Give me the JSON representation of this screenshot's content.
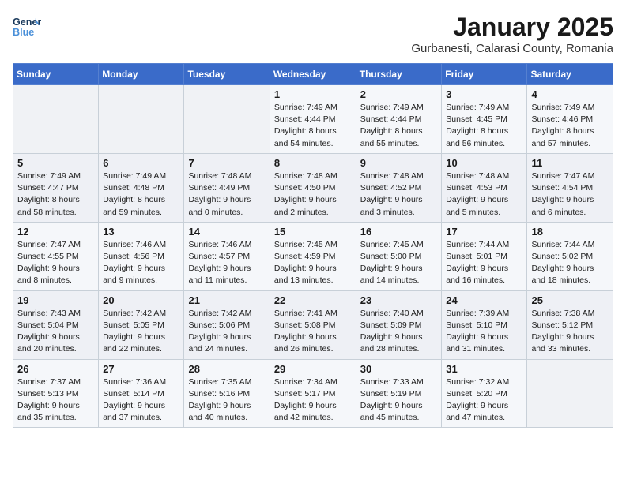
{
  "header": {
    "logo_line1": "General",
    "logo_line2": "Blue",
    "title": "January 2025",
    "subtitle": "Gurbanesti, Calarasi County, Romania"
  },
  "weekdays": [
    "Sunday",
    "Monday",
    "Tuesday",
    "Wednesday",
    "Thursday",
    "Friday",
    "Saturday"
  ],
  "weeks": [
    [
      {
        "day": "",
        "info": ""
      },
      {
        "day": "",
        "info": ""
      },
      {
        "day": "",
        "info": ""
      },
      {
        "day": "1",
        "info": "Sunrise: 7:49 AM\nSunset: 4:44 PM\nDaylight: 8 hours\nand 54 minutes."
      },
      {
        "day": "2",
        "info": "Sunrise: 7:49 AM\nSunset: 4:44 PM\nDaylight: 8 hours\nand 55 minutes."
      },
      {
        "day": "3",
        "info": "Sunrise: 7:49 AM\nSunset: 4:45 PM\nDaylight: 8 hours\nand 56 minutes."
      },
      {
        "day": "4",
        "info": "Sunrise: 7:49 AM\nSunset: 4:46 PM\nDaylight: 8 hours\nand 57 minutes."
      }
    ],
    [
      {
        "day": "5",
        "info": "Sunrise: 7:49 AM\nSunset: 4:47 PM\nDaylight: 8 hours\nand 58 minutes."
      },
      {
        "day": "6",
        "info": "Sunrise: 7:49 AM\nSunset: 4:48 PM\nDaylight: 8 hours\nand 59 minutes."
      },
      {
        "day": "7",
        "info": "Sunrise: 7:48 AM\nSunset: 4:49 PM\nDaylight: 9 hours\nand 0 minutes."
      },
      {
        "day": "8",
        "info": "Sunrise: 7:48 AM\nSunset: 4:50 PM\nDaylight: 9 hours\nand 2 minutes."
      },
      {
        "day": "9",
        "info": "Sunrise: 7:48 AM\nSunset: 4:52 PM\nDaylight: 9 hours\nand 3 minutes."
      },
      {
        "day": "10",
        "info": "Sunrise: 7:48 AM\nSunset: 4:53 PM\nDaylight: 9 hours\nand 5 minutes."
      },
      {
        "day": "11",
        "info": "Sunrise: 7:47 AM\nSunset: 4:54 PM\nDaylight: 9 hours\nand 6 minutes."
      }
    ],
    [
      {
        "day": "12",
        "info": "Sunrise: 7:47 AM\nSunset: 4:55 PM\nDaylight: 9 hours\nand 8 minutes."
      },
      {
        "day": "13",
        "info": "Sunrise: 7:46 AM\nSunset: 4:56 PM\nDaylight: 9 hours\nand 9 minutes."
      },
      {
        "day": "14",
        "info": "Sunrise: 7:46 AM\nSunset: 4:57 PM\nDaylight: 9 hours\nand 11 minutes."
      },
      {
        "day": "15",
        "info": "Sunrise: 7:45 AM\nSunset: 4:59 PM\nDaylight: 9 hours\nand 13 minutes."
      },
      {
        "day": "16",
        "info": "Sunrise: 7:45 AM\nSunset: 5:00 PM\nDaylight: 9 hours\nand 14 minutes."
      },
      {
        "day": "17",
        "info": "Sunrise: 7:44 AM\nSunset: 5:01 PM\nDaylight: 9 hours\nand 16 minutes."
      },
      {
        "day": "18",
        "info": "Sunrise: 7:44 AM\nSunset: 5:02 PM\nDaylight: 9 hours\nand 18 minutes."
      }
    ],
    [
      {
        "day": "19",
        "info": "Sunrise: 7:43 AM\nSunset: 5:04 PM\nDaylight: 9 hours\nand 20 minutes."
      },
      {
        "day": "20",
        "info": "Sunrise: 7:42 AM\nSunset: 5:05 PM\nDaylight: 9 hours\nand 22 minutes."
      },
      {
        "day": "21",
        "info": "Sunrise: 7:42 AM\nSunset: 5:06 PM\nDaylight: 9 hours\nand 24 minutes."
      },
      {
        "day": "22",
        "info": "Sunrise: 7:41 AM\nSunset: 5:08 PM\nDaylight: 9 hours\nand 26 minutes."
      },
      {
        "day": "23",
        "info": "Sunrise: 7:40 AM\nSunset: 5:09 PM\nDaylight: 9 hours\nand 28 minutes."
      },
      {
        "day": "24",
        "info": "Sunrise: 7:39 AM\nSunset: 5:10 PM\nDaylight: 9 hours\nand 31 minutes."
      },
      {
        "day": "25",
        "info": "Sunrise: 7:38 AM\nSunset: 5:12 PM\nDaylight: 9 hours\nand 33 minutes."
      }
    ],
    [
      {
        "day": "26",
        "info": "Sunrise: 7:37 AM\nSunset: 5:13 PM\nDaylight: 9 hours\nand 35 minutes."
      },
      {
        "day": "27",
        "info": "Sunrise: 7:36 AM\nSunset: 5:14 PM\nDaylight: 9 hours\nand 37 minutes."
      },
      {
        "day": "28",
        "info": "Sunrise: 7:35 AM\nSunset: 5:16 PM\nDaylight: 9 hours\nand 40 minutes."
      },
      {
        "day": "29",
        "info": "Sunrise: 7:34 AM\nSunset: 5:17 PM\nDaylight: 9 hours\nand 42 minutes."
      },
      {
        "day": "30",
        "info": "Sunrise: 7:33 AM\nSunset: 5:19 PM\nDaylight: 9 hours\nand 45 minutes."
      },
      {
        "day": "31",
        "info": "Sunrise: 7:32 AM\nSunset: 5:20 PM\nDaylight: 9 hours\nand 47 minutes."
      },
      {
        "day": "",
        "info": ""
      }
    ]
  ]
}
